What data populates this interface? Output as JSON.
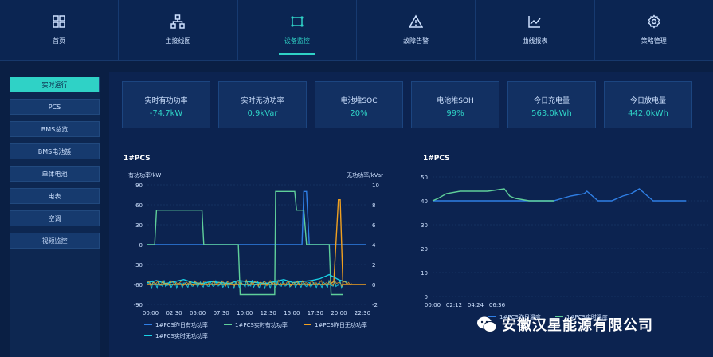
{
  "nav": {
    "items": [
      {
        "label": "首页",
        "icon": "grid-icon"
      },
      {
        "label": "主接线图",
        "icon": "topology-icon"
      },
      {
        "label": "设备监控",
        "icon": "monitor-icon",
        "active": true
      },
      {
        "label": "故障告警",
        "icon": "warning-icon"
      },
      {
        "label": "曲线报表",
        "icon": "line-chart-icon"
      },
      {
        "label": "策略管理",
        "icon": "gear-icon"
      }
    ]
  },
  "sidebar": {
    "items": [
      {
        "label": "实时运行",
        "active": true
      },
      {
        "label": "PCS"
      },
      {
        "label": "BMS总览"
      },
      {
        "label": "BMS电池簇"
      },
      {
        "label": "单体电池"
      },
      {
        "label": "电表"
      },
      {
        "label": "空调"
      },
      {
        "label": "视频监控"
      }
    ]
  },
  "stats": [
    {
      "label": "实时有功功率",
      "value": "-74.7kW"
    },
    {
      "label": "实时无功功率",
      "value": "0.9kVar"
    },
    {
      "label": "电池堆SOC",
      "value": "20%"
    },
    {
      "label": "电池堆SOH",
      "value": "99%"
    },
    {
      "label": "今日充电量",
      "value": "563.0kWh"
    },
    {
      "label": "今日放电量",
      "value": "442.0kWh"
    }
  ],
  "colors": {
    "accent": "#2fd2c6",
    "blue": "#2f7fe6",
    "green": "#5fcf9a",
    "orange": "#f0a020",
    "cyan": "#19d2e6"
  },
  "chart_left": {
    "title": "1#PCS",
    "ylabel_left": "有功功率/kW",
    "ylabel_right": "无功功率/kVar",
    "yticks_left": [
      "90",
      "60",
      "30",
      "0",
      "-30",
      "-60",
      "-90"
    ],
    "yticks_right": [
      "10",
      "8",
      "6",
      "4",
      "2",
      "0",
      "-2"
    ],
    "xticks": [
      "00:00",
      "02:30",
      "05:00",
      "07:30",
      "10:00",
      "12:30",
      "15:00",
      "17:30",
      "20:00",
      "22:30"
    ],
    "legend": [
      "1#PCS昨日有功功率",
      "1#PCS实时有功功率",
      "1#PCS昨日无功功率",
      "1#PCS实时无功功率"
    ]
  },
  "chart_right": {
    "title": "1#PCS",
    "yticks": [
      "50",
      "40",
      "30",
      "20",
      "10",
      "0"
    ],
    "xticks": [
      "00:00",
      "02:12",
      "04:24",
      "06:36"
    ],
    "legend": [
      "1#PCS昨日温度",
      "1#PCS实时温度"
    ]
  },
  "chart_data": [
    {
      "type": "line",
      "title": "1#PCS",
      "xlabel": "",
      "ylabel": "有功功率/kW",
      "ylabel_right": "无功功率/kVar",
      "ylim": [
        -90,
        90
      ],
      "ylim_right": [
        -2,
        10
      ],
      "series": [
        {
          "name": "1#PCS昨日有功功率",
          "axis": "left",
          "x": [
            0,
            17,
            17.2,
            17.5,
            17.8,
            18,
            19,
            24
          ],
          "y": [
            0,
            0,
            80,
            80,
            0,
            0,
            0,
            0
          ]
        },
        {
          "name": "1#PCS实时有功功率",
          "axis": "left",
          "x": [
            0,
            0.8,
            1,
            6,
            6.2,
            10,
            10.2,
            14,
            14.1,
            16.2,
            16.4,
            17.2,
            17.5,
            20,
            20.2,
            21.5
          ],
          "y": [
            0,
            0,
            52,
            52,
            0,
            0,
            -75,
            -75,
            80,
            80,
            52,
            52,
            0,
            0,
            -75,
            -75
          ]
        },
        {
          "name": "1#PCS昨日无功功率",
          "axis": "right",
          "x": [
            0,
            20,
            20.5,
            21,
            21.2,
            21.5,
            24
          ],
          "y": [
            0,
            0,
            0.3,
            8.5,
            8.5,
            0,
            0
          ]
        },
        {
          "name": "1#PCS实时无功功率",
          "axis": "right",
          "x": [
            0,
            1,
            2,
            3,
            4,
            5,
            6,
            7,
            8,
            9,
            10,
            11,
            12,
            13,
            14,
            15,
            16,
            17,
            18,
            19,
            20,
            21,
            22
          ],
          "y": [
            0.2,
            0.4,
            0.1,
            0.3,
            0.5,
            0.2,
            0.1,
            0.3,
            0.2,
            0.1,
            0.4,
            0.3,
            0.2,
            0.1,
            0.3,
            0.5,
            0.2,
            0.3,
            0.4,
            0.6,
            1,
            0.5,
            0.2
          ]
        }
      ]
    },
    {
      "type": "line",
      "title": "1#PCS",
      "xlabel": "",
      "ylabel": "",
      "ylim": [
        0,
        50
      ],
      "series": [
        {
          "name": "1#PCS昨日温度",
          "x": [
            0,
            0.3,
            0.6,
            2.5,
            3.0,
            4.4,
            4.7,
            5.0,
            5.5,
            5.6,
            6.0,
            6.5,
            6.9,
            7.2,
            7.5,
            8.0,
            8.2,
            9.2
          ],
          "y": [
            40,
            40,
            40,
            40,
            40,
            40,
            41,
            42,
            43,
            44,
            40,
            40,
            42,
            43,
            45,
            40,
            40,
            40
          ]
        },
        {
          "name": "1#PCS实时温度",
          "x": [
            0,
            0.2,
            0.5,
            1.0,
            2.0,
            2.6,
            2.8,
            3.0,
            3.5,
            3.8,
            4.4
          ],
          "y": [
            40,
            41,
            43,
            44,
            44,
            45,
            42,
            41,
            40,
            40,
            40
          ]
        }
      ]
    }
  ],
  "watermark": "安徽汉星能源有限公司"
}
